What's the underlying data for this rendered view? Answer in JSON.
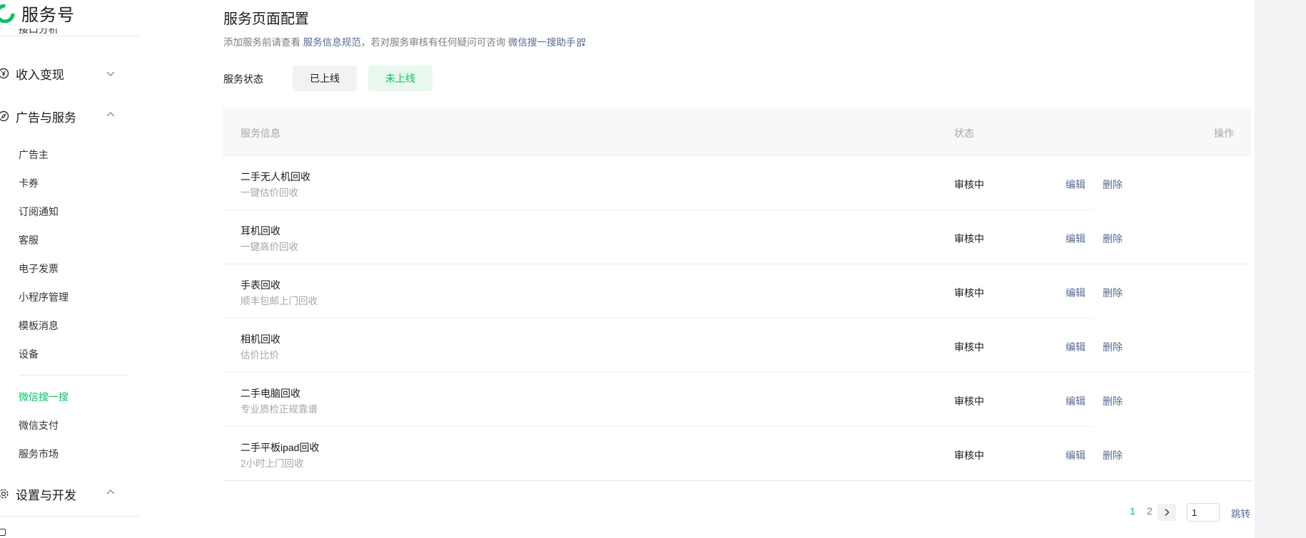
{
  "brand": {
    "name": "服务号",
    "accent": "#07c160"
  },
  "sidebar": {
    "cut_item": "接口分析",
    "groups": [
      {
        "label": "收入变现",
        "icon": "yen-circle-icon",
        "expanded": false
      },
      {
        "label": "广告与服务",
        "icon": "compass-icon",
        "expanded": true
      },
      {
        "label": "设置与开发",
        "icon": "gear-icon",
        "expanded": true
      }
    ],
    "items": [
      {
        "label": "广告主"
      },
      {
        "label": "卡券"
      },
      {
        "label": "订阅通知"
      },
      {
        "label": "客服"
      },
      {
        "label": "电子发票"
      },
      {
        "label": "小程序管理"
      },
      {
        "label": "模板消息"
      },
      {
        "label": "设备"
      }
    ],
    "items2": [
      {
        "label": "微信搜一搜",
        "active": true
      },
      {
        "label": "微信支付"
      },
      {
        "label": "服务市场"
      }
    ]
  },
  "main": {
    "title": "服务页面配置",
    "desc_prefix": "添加服务前请查看 ",
    "desc_link1": "服务信息规范",
    "desc_middle": "，若对服务审核有任何疑问可咨询 ",
    "desc_link2": "微信搜一搜助手",
    "status_label": "服务状态",
    "btn_online": "已上线",
    "btn_offline": "未上线"
  },
  "table": {
    "headers": {
      "info": "服务信息",
      "status": "状态",
      "ops": "操作"
    },
    "rows": [
      {
        "title": "二手无人机回收",
        "sub": "一键估价回收",
        "status": "审核中",
        "edit": "编辑",
        "del": "删除"
      },
      {
        "title": "耳机回收",
        "sub": "一键高价回收",
        "status": "审核中",
        "edit": "编辑",
        "del": "删除"
      },
      {
        "title": "手表回收",
        "sub": "顺丰包邮上门回收",
        "status": "审核中",
        "edit": "编辑",
        "del": "删除"
      },
      {
        "title": "相机回收",
        "sub": "估价比价",
        "status": "审核中",
        "edit": "编辑",
        "del": "删除"
      },
      {
        "title": "二手电脑回收",
        "sub": "专业质检正规靠谱",
        "status": "审核中",
        "edit": "编辑",
        "del": "删除"
      },
      {
        "title": "二手平板ipad回收",
        "sub": "2小时上门回收",
        "status": "审核中",
        "edit": "编辑",
        "del": "删除"
      }
    ]
  },
  "pagination": {
    "page1": "1",
    "page2": "2",
    "input_value": "1",
    "jump": "跳转"
  }
}
